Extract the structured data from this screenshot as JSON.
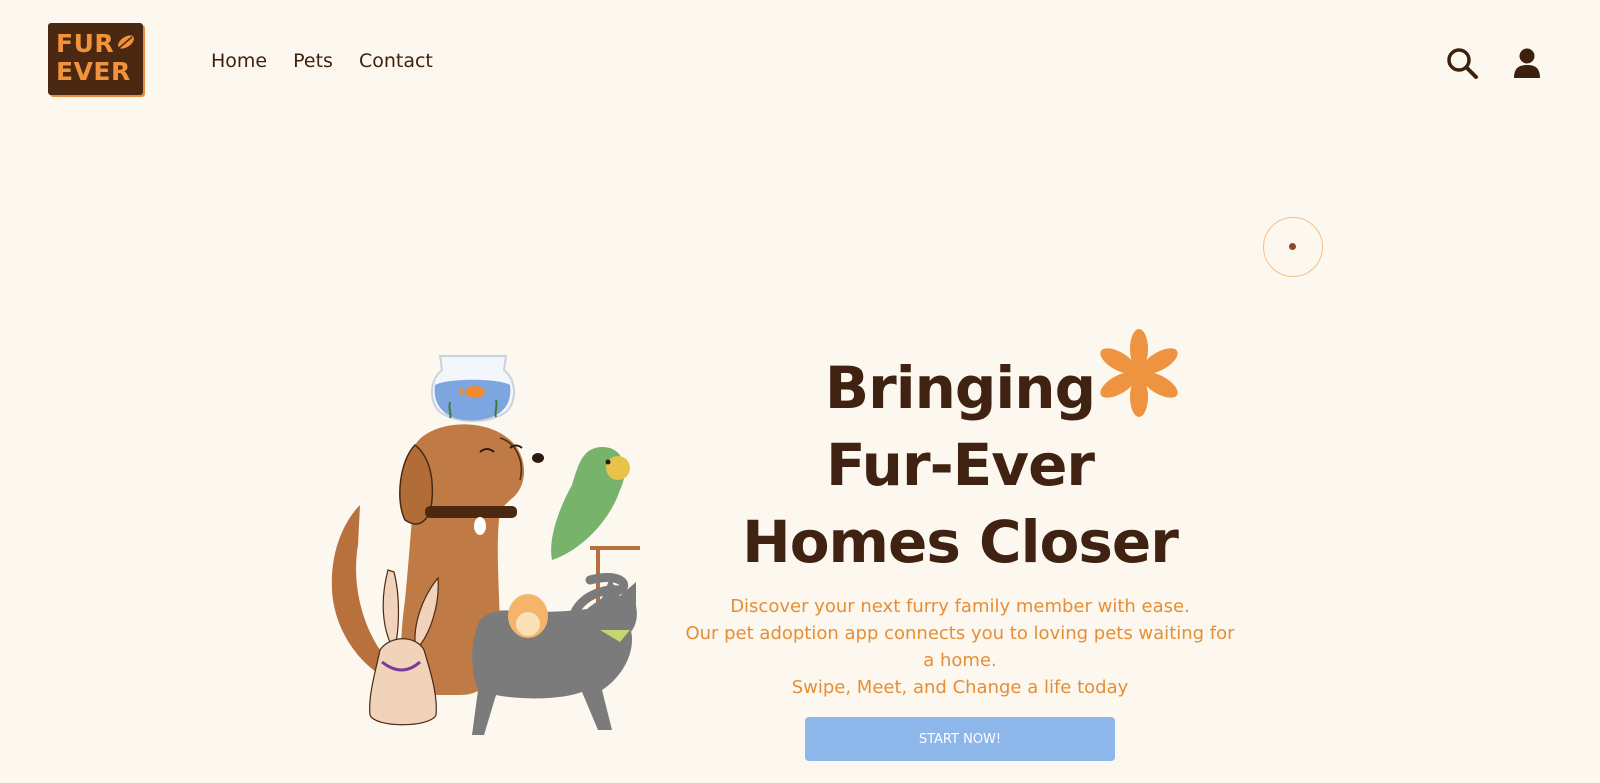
{
  "brand": {
    "logo_line1": "FUR",
    "logo_line2": "EVER",
    "colors": {
      "logo_bg": "#4b2812",
      "logo_text": "#f0933a",
      "background": "#fdf8ef",
      "accent": "#e58e36",
      "cta": "#8db6ea"
    }
  },
  "nav": {
    "items": [
      {
        "label": "Home"
      },
      {
        "label": "Pets"
      },
      {
        "label": "Contact"
      }
    ],
    "icons": [
      "search-icon",
      "user-icon"
    ]
  },
  "hero": {
    "title_lines": [
      "Bringing",
      "Fur-Ever",
      "Homes Closer"
    ],
    "subtitle_lines": [
      "Discover your next furry family member with ease.",
      "Our pet adoption app connects you to loving pets waiting for",
      "a home.",
      "Swipe, Meet, and Change a life today"
    ],
    "cta_label": "START NOW!"
  }
}
